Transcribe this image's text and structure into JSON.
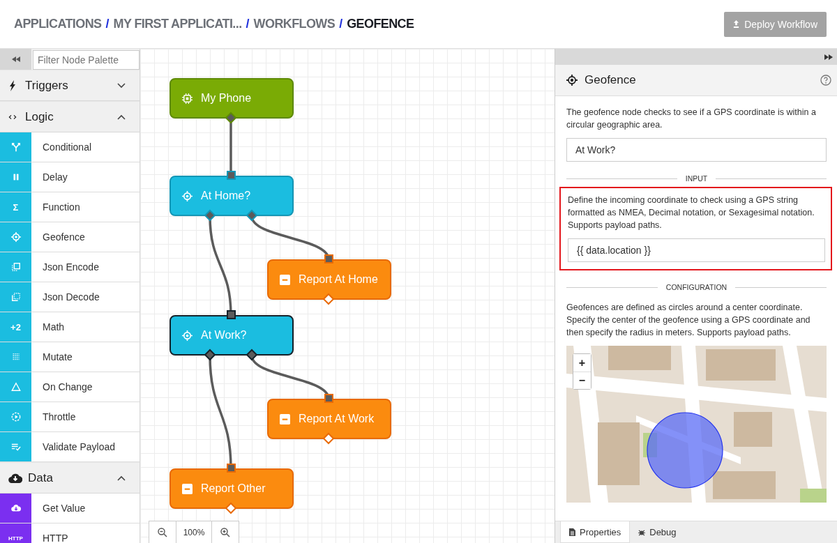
{
  "breadcrumbs": [
    {
      "label": "APPLICATIONS",
      "current": false
    },
    {
      "label": "MY FIRST APPLICATI...",
      "current": false
    },
    {
      "label": "WORKFLOWS",
      "current": false
    },
    {
      "label": "GEOFENCE",
      "current": true
    }
  ],
  "separator": "/",
  "deploy_button": {
    "label": "Deploy Workflow",
    "disabled": true
  },
  "palette": {
    "filter": {
      "placeholder": "Filter Node Palette"
    },
    "categories": [
      {
        "label": "Triggers",
        "kind": "triggers",
        "expanded": false
      },
      {
        "label": "Logic",
        "kind": "logic",
        "expanded": true,
        "items": [
          {
            "label": "Conditional"
          },
          {
            "label": "Delay"
          },
          {
            "label": "Function",
            "glyph": "Σ"
          },
          {
            "label": "Geofence"
          },
          {
            "label": "Json Encode"
          },
          {
            "label": "Json Decode"
          },
          {
            "label": "Math",
            "glyph": "+2"
          },
          {
            "label": "Mutate"
          },
          {
            "label": "On Change"
          },
          {
            "label": "Throttle"
          },
          {
            "label": "Validate Payload"
          }
        ]
      },
      {
        "label": "Data",
        "kind": "data",
        "expanded": true,
        "items": [
          {
            "label": "Get Value"
          },
          {
            "label": "HTTP",
            "glyph": "HTTP"
          }
        ]
      }
    ]
  },
  "canvas": {
    "nodes": [
      {
        "label": "My Phone",
        "kind": "device",
        "selected": false
      },
      {
        "label": "At Home?",
        "kind": "geofence",
        "selected": false
      },
      {
        "label": "Report At Home",
        "kind": "debug",
        "selected": false
      },
      {
        "label": "At Work?",
        "kind": "geofence",
        "selected": true
      },
      {
        "label": "Report At Work",
        "kind": "debug",
        "selected": false
      },
      {
        "label": "Report Other",
        "kind": "debug",
        "selected": false
      }
    ],
    "zoom": {
      "value": "100%"
    }
  },
  "panel": {
    "title": "Geofence",
    "description": "The geofence node checks to see if a GPS coordinate is within a circular geographic area.",
    "name_field": {
      "value": "At Work?"
    },
    "sections": [
      {
        "title": "INPUT",
        "highlighted": true,
        "description": "Define the incoming coordinate to check using a GPS string formatted as NMEA, Decimal notation, or Sexagesimal notation. Supports payload paths.",
        "field": {
          "value": "{{ data.location }}"
        }
      },
      {
        "title": "CONFIGURATION",
        "highlighted": false,
        "description": "Geofences are defined as circles around a center coordinate. Specify the center of the geofence using a GPS coordinate and then specify the radius in meters. Supports payload paths.",
        "map": {
          "kind": "picture",
          "zoom_in": "+",
          "zoom_out": "−"
        }
      }
    ],
    "tabs": [
      {
        "label": "Properties",
        "selected": true
      },
      {
        "label": "Debug",
        "selected": false
      }
    ]
  }
}
